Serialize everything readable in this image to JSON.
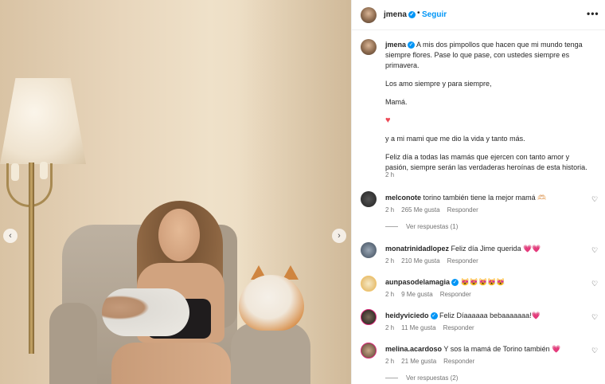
{
  "header": {
    "username": "jmena",
    "follow_label": "Seguir",
    "dot": "•",
    "more": "•••"
  },
  "photo": {
    "prev": "‹",
    "next": "›"
  },
  "caption": {
    "username": "jmena",
    "line1": "A mis dos pimpollos que hacen que mi mundo tenga siempre flores. Pase lo que pase, con ustedes siempre es primavera.",
    "line2": "Los amo siempre y para siempre,",
    "line3": "Mamá.",
    "heart": "♥",
    "line4": "y a mi mami que me dio la vida y tanto más.",
    "line5": "Feliz día a todas las mamás que ejercen con tanto amor y pasión, siempre serán las verdaderas heroínas de esta historia.",
    "time": "2 h"
  },
  "comments": [
    {
      "user": "melconote",
      "text": "torino también tiene la mejor mamá 🫶🏻",
      "time": "2 h",
      "likes": "265 Me gusta",
      "reply": "Responder",
      "replies": "Ver respuestas (1)"
    },
    {
      "user": "monatrinidadlopez",
      "text": "Feliz día Jime querida 💗💗",
      "time": "2 h",
      "likes": "210 Me gusta",
      "reply": "Responder"
    },
    {
      "user": "aunpasodelamagia",
      "text": "😻😻😻😻😻",
      "time": "2 h",
      "likes": "9 Me gusta",
      "reply": "Responder"
    },
    {
      "user": "heidyviciedo",
      "text": "Feliz Díaaaaaa bebaaaaaaa!💗",
      "time": "2 h",
      "likes": "11 Me gusta",
      "reply": "Responder"
    },
    {
      "user": "melina.acardoso",
      "text": "Y sos la mamá de Torino también 💗",
      "time": "2 h",
      "likes": "21 Me gusta",
      "reply": "Responder",
      "replies": "Ver respuestas (2)"
    }
  ],
  "icons": {
    "like": "♡",
    "verified": "✓"
  },
  "colors": {
    "accent": "#0095f6",
    "heart": "#ed4956",
    "muted": "#737373"
  }
}
